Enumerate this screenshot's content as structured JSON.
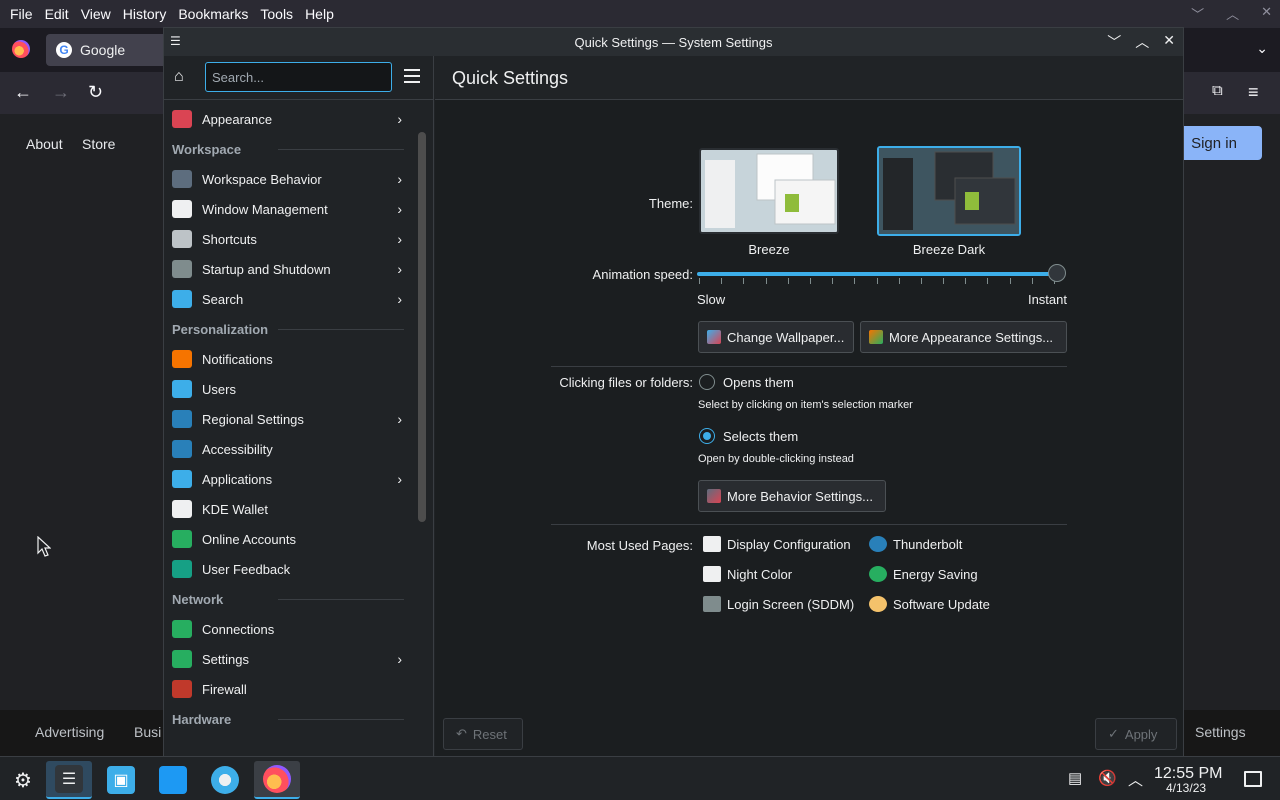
{
  "firefox": {
    "menu": [
      "File",
      "Edit",
      "View",
      "History",
      "Bookmarks",
      "Tools",
      "Help"
    ],
    "tab_title": "Google",
    "top_links": [
      "About",
      "Store"
    ],
    "sign_in": "Sign in",
    "footer_links": [
      "Advertising",
      "Busi",
      "Settings"
    ]
  },
  "window": {
    "title": "Quick Settings — System Settings"
  },
  "sidebar": {
    "search_placeholder": "Search...",
    "items": [
      {
        "type": "item",
        "label": "Appearance",
        "icon": "appearance-icon",
        "color": "#da4453",
        "chevron": true
      },
      {
        "type": "category",
        "label": "Workspace"
      },
      {
        "type": "item",
        "label": "Workspace Behavior",
        "icon": "workspace-behavior-icon",
        "color": "#5d6d7e",
        "chevron": true
      },
      {
        "type": "item",
        "label": "Window Management",
        "icon": "window-management-icon",
        "color": "#eff0f1",
        "chevron": true
      },
      {
        "type": "item",
        "label": "Shortcuts",
        "icon": "keyboard-icon",
        "color": "#bdc3c7",
        "chevron": true
      },
      {
        "type": "item",
        "label": "Startup and Shutdown",
        "icon": "startup-icon",
        "color": "#7f8c8d",
        "chevron": true
      },
      {
        "type": "item",
        "label": "Search",
        "icon": "search-icon",
        "color": "#3daee9",
        "chevron": true
      },
      {
        "type": "category",
        "label": "Personalization"
      },
      {
        "type": "item",
        "label": "Notifications",
        "icon": "bell-icon",
        "color": "#f67400",
        "chevron": false
      },
      {
        "type": "item",
        "label": "Users",
        "icon": "users-icon",
        "color": "#3daee9",
        "chevron": false
      },
      {
        "type": "item",
        "label": "Regional Settings",
        "icon": "regional-icon",
        "color": "#2980b9",
        "chevron": true
      },
      {
        "type": "item",
        "label": "Accessibility",
        "icon": "accessibility-icon",
        "color": "#2980b9",
        "chevron": false
      },
      {
        "type": "item",
        "label": "Applications",
        "icon": "applications-icon",
        "color": "#3daee9",
        "chevron": true
      },
      {
        "type": "item",
        "label": "KDE Wallet",
        "icon": "wallet-icon",
        "color": "#eff0f1",
        "chevron": false
      },
      {
        "type": "item",
        "label": "Online Accounts",
        "icon": "globe-icon",
        "color": "#27ae60",
        "chevron": false
      },
      {
        "type": "item",
        "label": "User Feedback",
        "icon": "feedback-icon",
        "color": "#16a085",
        "chevron": false
      },
      {
        "type": "category",
        "label": "Network"
      },
      {
        "type": "item",
        "label": "Connections",
        "icon": "globe-icon",
        "color": "#27ae60",
        "chevron": false
      },
      {
        "type": "item",
        "label": "Settings",
        "icon": "globe-icon",
        "color": "#27ae60",
        "chevron": true
      },
      {
        "type": "item",
        "label": "Firewall",
        "icon": "firewall-icon",
        "color": "#c0392b",
        "chevron": false
      },
      {
        "type": "category",
        "label": "Hardware"
      }
    ]
  },
  "main": {
    "title": "Quick Settings",
    "theme_label": "Theme:",
    "themes": [
      {
        "name": "Breeze",
        "selected": false
      },
      {
        "name": "Breeze Dark",
        "selected": true
      }
    ],
    "animation_label": "Animation speed:",
    "animation_min": "Slow",
    "animation_max": "Instant",
    "animation_value": 1.0,
    "btn_wallpaper": "Change Wallpaper...",
    "btn_appearance": "More Appearance Settings...",
    "clicking_label": "Clicking files or folders:",
    "opt_open": "Opens them",
    "opt_open_hint": "Select by clicking on item's selection marker",
    "opt_select": "Selects them",
    "opt_select_hint": "Open by double-clicking instead",
    "selected_option": "Selects them",
    "btn_behavior": "More Behavior Settings...",
    "most_used_label": "Most Used Pages:",
    "most_used": [
      {
        "label": "Display Configuration",
        "icon": "monitor-icon"
      },
      {
        "label": "Thunderbolt",
        "icon": "thunderbolt-icon"
      },
      {
        "label": "Night Color",
        "icon": "monitor-icon"
      },
      {
        "label": "Energy Saving",
        "icon": "energy-icon"
      },
      {
        "label": "Login Screen (SDDM)",
        "icon": "login-screen-icon"
      },
      {
        "label": "Software Update",
        "icon": "update-icon"
      }
    ],
    "reset": "Reset",
    "apply": "Apply"
  },
  "taskbar": {
    "time": "12:55 PM",
    "date": "4/13/23"
  }
}
